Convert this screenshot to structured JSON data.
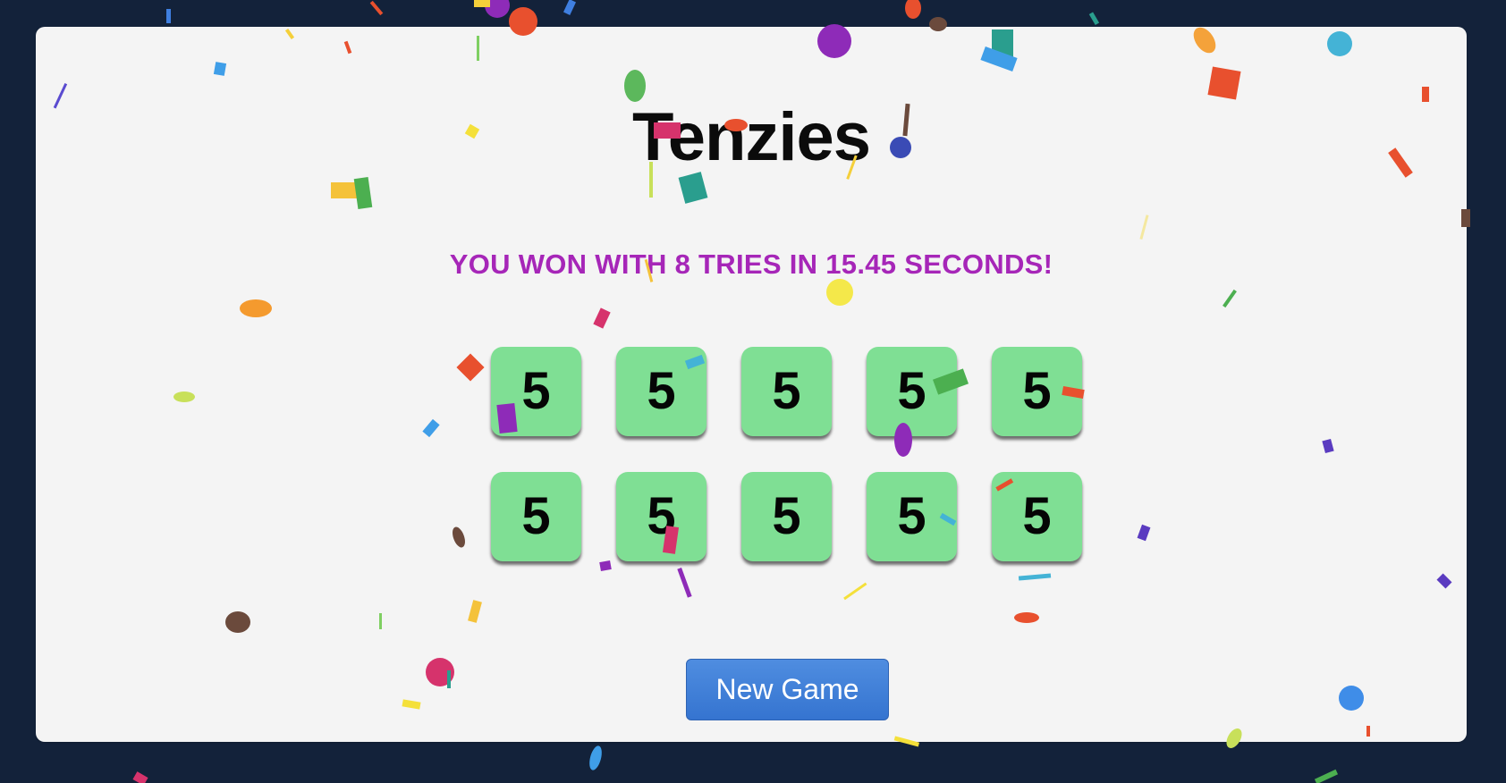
{
  "game": {
    "title": "Tenzies",
    "win_message": "YOU WON WITH 8 TRIES IN 15.45 SECONDS!",
    "dice": [
      {
        "value": "5",
        "held": true
      },
      {
        "value": "5",
        "held": true
      },
      {
        "value": "5",
        "held": true
      },
      {
        "value": "5",
        "held": true
      },
      {
        "value": "5",
        "held": true
      },
      {
        "value": "5",
        "held": true
      },
      {
        "value": "5",
        "held": true
      },
      {
        "value": "5",
        "held": true
      },
      {
        "value": "5",
        "held": true
      },
      {
        "value": "5",
        "held": true
      }
    ],
    "new_game_label": "New Game"
  },
  "colors": {
    "page_background": "#13223a",
    "card_background": "#f4f4f4",
    "held_die": "#7fdf94",
    "win_message": "#a626b8",
    "button": "#3f80d8"
  },
  "decoration": {
    "effect": "confetti"
  }
}
